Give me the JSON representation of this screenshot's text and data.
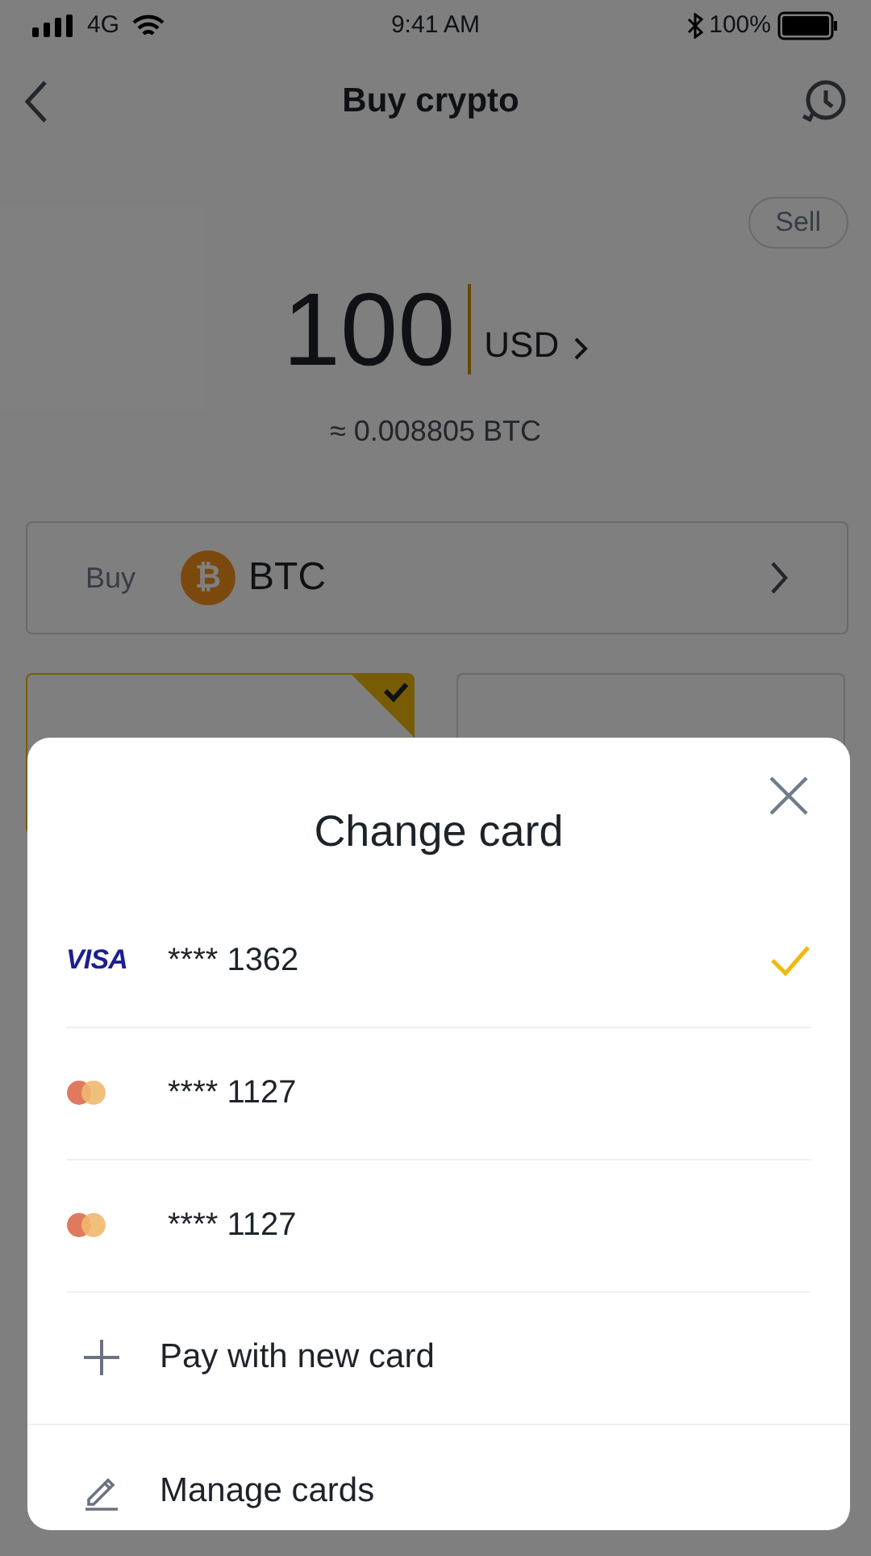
{
  "status_bar": {
    "network": "4G",
    "time": "9:41 AM",
    "battery": "100%"
  },
  "header": {
    "title": "Buy crypto"
  },
  "sell_button": "Sell",
  "amount": {
    "value": "100",
    "currency": "USD",
    "estimate": "≈ 0.008805 BTC"
  },
  "asset_selector": {
    "label": "Buy",
    "coin_symbol": "₿",
    "coin": "BTC"
  },
  "payment_options": [
    {
      "selected": true
    },
    {
      "selected": false
    }
  ],
  "sheet": {
    "title": "Change card",
    "cards": [
      {
        "kind": "visa",
        "logo_text": "VISA",
        "number": "**** 1362",
        "selected": true
      },
      {
        "kind": "mastercard",
        "number": "**** 1127",
        "selected": false
      },
      {
        "kind": "mastercard",
        "number": "**** 1127",
        "selected": false
      }
    ],
    "actions": [
      {
        "kind": "add",
        "label": "Pay with new card"
      },
      {
        "kind": "edit",
        "label": "Manage cards"
      }
    ]
  }
}
